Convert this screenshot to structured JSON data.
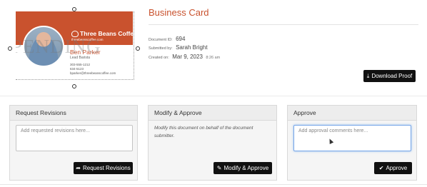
{
  "card": {
    "watermark": "PENDING",
    "brand": "Three Beans Coffee",
    "website": "threebeanscoffee.com",
    "name": "Ben Parker",
    "role": "Lead Barista",
    "phone1": "303-555-1212",
    "phone2": "634-5123",
    "email": "bparker@threebeanscoffee.com"
  },
  "header": {
    "title": "Business Card",
    "doc_id_label": "Document ID:",
    "doc_id": "694",
    "submitted_label": "Submitted by:",
    "submitted_by": "Sarah Bright",
    "created_label": "Created on:",
    "created_date": "Mar 9, 2023",
    "created_time": "8:26 am",
    "download_label": "Download Proof"
  },
  "panels": {
    "revisions": {
      "title": "Request Revisions",
      "placeholder": "Add requested revisions here...",
      "button": "Request Revisions"
    },
    "modify": {
      "title": "Modify & Approve",
      "description": "Modify this document on behalf of the document submitter.",
      "button": "Modify & Approve"
    },
    "approve": {
      "title": "Approve",
      "placeholder": "Add approval comments here...",
      "button": "Approve"
    }
  },
  "colors": {
    "brand": "#c9522e",
    "button": "#111111",
    "focus": "#76a6e8"
  },
  "icons": {
    "download": "download-icon",
    "request": "share-arrow-icon",
    "modify": "pencil-icon",
    "approve": "checkmark-icon"
  }
}
